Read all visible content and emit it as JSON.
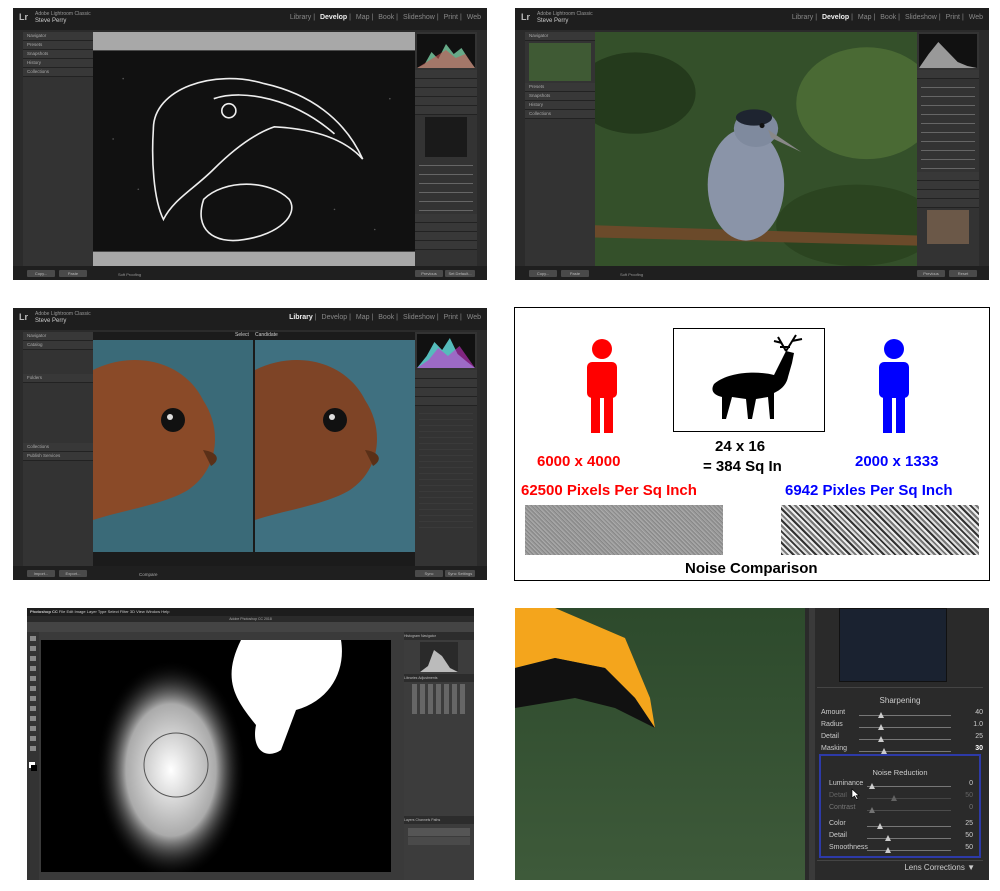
{
  "tiles": {
    "develop_toucan": {
      "modules": [
        "Library",
        "Develop",
        "Map",
        "Book",
        "Slideshow",
        "Print",
        "Web"
      ],
      "active": "Develop",
      "user": "Steve Perry",
      "left_sections": [
        "Navigator",
        "Presets",
        "Snapshots",
        "History",
        "Collections"
      ],
      "bottom_left": [
        "Copy...",
        "Paste"
      ],
      "bottom_right": [
        "Previous",
        "Set Default..."
      ],
      "toolbar_text": "Soft Proofing"
    },
    "develop_heron": {
      "modules": [
        "Library",
        "Develop",
        "Map",
        "Book",
        "Slideshow",
        "Print",
        "Web"
      ],
      "active": "Develop",
      "user": "Steve Perry",
      "left_sections": [
        "Navigator",
        "Presets",
        "Snapshots",
        "History",
        "Collections"
      ],
      "bottom_left": [
        "Copy...",
        "Paste"
      ],
      "bottom_right": [
        "Previous",
        "Reset"
      ],
      "toolbar_text": "Soft Proofing"
    },
    "library_squirrel": {
      "modules": [
        "Library",
        "Develop",
        "Map",
        "Book",
        "Slideshow",
        "Print",
        "Web"
      ],
      "active": "Library",
      "user": "Steve Perry",
      "select_label": "Select",
      "candidate_label": "Candidate",
      "left_sections": [
        "Navigator",
        "Catalog",
        "Folders",
        "Collections",
        "Publish Services"
      ],
      "bottom_left": [
        "Import...",
        "Export..."
      ],
      "bottom_right": [
        "Sync",
        "Sync Settings"
      ],
      "compare_label": "Compare"
    },
    "infographic": {
      "center_dim": "24 x 16",
      "center_area": "= 384 Sq In",
      "left_res": "6000 x 4000",
      "left_ppi": "62500 Pixels Per Sq Inch",
      "right_res": "2000 x 1333",
      "right_ppi": "6942 Pixles Per Sq Inch",
      "caption": "Noise Comparison",
      "colors": {
        "left": "#ff0000",
        "right": "#0000ff"
      }
    },
    "photoshop": {
      "app": "Photoshop CC",
      "menus": [
        "File",
        "Edit",
        "Image",
        "Layer",
        "Type",
        "Select",
        "Filter",
        "3D",
        "View",
        "Window",
        "Help"
      ],
      "title": "Adobe Photoshop CC 2018",
      "panel_tabs": [
        "Histogram",
        "Navigator"
      ],
      "adjust_tabs": [
        "Libraries",
        "Adjustments"
      ],
      "layer_tabs": [
        "Layers",
        "Channels",
        "Paths"
      ]
    },
    "lr_zoom": {
      "sharpening_title": "Sharpening",
      "sharpening": [
        {
          "label": "Amount",
          "value": "40"
        },
        {
          "label": "Radius",
          "value": "1.0"
        },
        {
          "label": "Detail",
          "value": "25"
        },
        {
          "label": "Masking",
          "value": "30"
        }
      ],
      "noise_title": "Noise Reduction",
      "noise": [
        {
          "label": "Luminance",
          "value": "0"
        },
        {
          "label": "Detail",
          "value": "50"
        },
        {
          "label": "Contrast",
          "value": "0"
        },
        {
          "label": "Color",
          "value": "25"
        },
        {
          "label": "Detail",
          "value": "50"
        },
        {
          "label": "Smoothness",
          "value": "50"
        }
      ],
      "next_section": "Lens Corrections",
      "highlight_color": "#2d3aa8"
    }
  }
}
